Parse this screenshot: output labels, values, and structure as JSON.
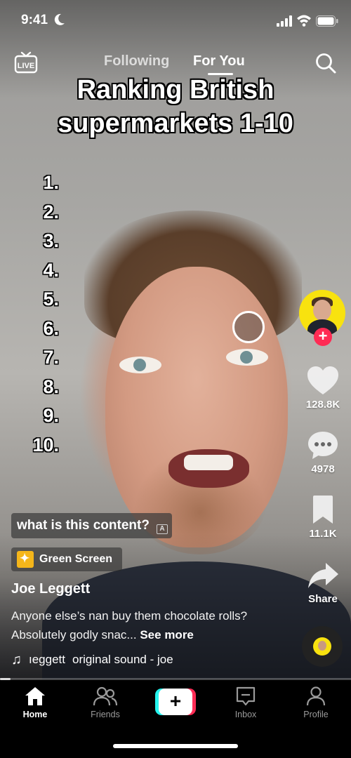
{
  "status_bar": {
    "time": "9:41"
  },
  "top_nav": {
    "tabs": [
      {
        "label": "Following",
        "active": false
      },
      {
        "label": "For You",
        "active": true
      }
    ]
  },
  "overlay": {
    "title_line1": "Ranking British",
    "title_line2": "supermarkets 1-10",
    "ranks": [
      "1.",
      "2.",
      "3.",
      "4.",
      "5.",
      "6.",
      "7.",
      "8.",
      "9.",
      "10."
    ]
  },
  "actions": {
    "likes": "128.8K",
    "comments": "4978",
    "saves": "11.1K",
    "share_label": "Share"
  },
  "post": {
    "sticker_text": "what is this content?",
    "effect_label": "Green Screen",
    "author": "Joe Leggett",
    "caption": "Anyone else’s nan buy them chocolate rolls? Absolutely godly snac...",
    "see_more": "See more",
    "sound_artist": "ıeggett",
    "sound_title": "original sound - joe",
    "progress": 0.03
  },
  "tab_bar": {
    "items": [
      {
        "label": "Home",
        "active": true
      },
      {
        "label": "Friends",
        "active": false
      },
      {
        "label": "Inbox",
        "active": false
      },
      {
        "label": "Profile",
        "active": false
      }
    ]
  },
  "colors": {
    "follow_plus": "#ff2b54",
    "avatar_bg": "#f8e20f",
    "create_left": "#25f4ee",
    "create_right": "#fe2c55"
  }
}
